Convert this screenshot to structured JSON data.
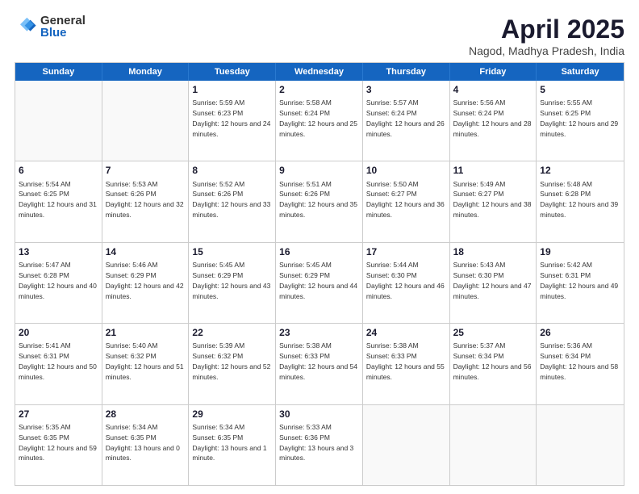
{
  "logo": {
    "general": "General",
    "blue": "Blue"
  },
  "title": "April 2025",
  "subtitle": "Nagod, Madhya Pradesh, India",
  "headers": [
    "Sunday",
    "Monday",
    "Tuesday",
    "Wednesday",
    "Thursday",
    "Friday",
    "Saturday"
  ],
  "rows": [
    [
      {
        "day": "",
        "text": ""
      },
      {
        "day": "",
        "text": ""
      },
      {
        "day": "1",
        "text": "Sunrise: 5:59 AM\nSunset: 6:23 PM\nDaylight: 12 hours and 24 minutes."
      },
      {
        "day": "2",
        "text": "Sunrise: 5:58 AM\nSunset: 6:24 PM\nDaylight: 12 hours and 25 minutes."
      },
      {
        "day": "3",
        "text": "Sunrise: 5:57 AM\nSunset: 6:24 PM\nDaylight: 12 hours and 26 minutes."
      },
      {
        "day": "4",
        "text": "Sunrise: 5:56 AM\nSunset: 6:24 PM\nDaylight: 12 hours and 28 minutes."
      },
      {
        "day": "5",
        "text": "Sunrise: 5:55 AM\nSunset: 6:25 PM\nDaylight: 12 hours and 29 minutes."
      }
    ],
    [
      {
        "day": "6",
        "text": "Sunrise: 5:54 AM\nSunset: 6:25 PM\nDaylight: 12 hours and 31 minutes."
      },
      {
        "day": "7",
        "text": "Sunrise: 5:53 AM\nSunset: 6:26 PM\nDaylight: 12 hours and 32 minutes."
      },
      {
        "day": "8",
        "text": "Sunrise: 5:52 AM\nSunset: 6:26 PM\nDaylight: 12 hours and 33 minutes."
      },
      {
        "day": "9",
        "text": "Sunrise: 5:51 AM\nSunset: 6:26 PM\nDaylight: 12 hours and 35 minutes."
      },
      {
        "day": "10",
        "text": "Sunrise: 5:50 AM\nSunset: 6:27 PM\nDaylight: 12 hours and 36 minutes."
      },
      {
        "day": "11",
        "text": "Sunrise: 5:49 AM\nSunset: 6:27 PM\nDaylight: 12 hours and 38 minutes."
      },
      {
        "day": "12",
        "text": "Sunrise: 5:48 AM\nSunset: 6:28 PM\nDaylight: 12 hours and 39 minutes."
      }
    ],
    [
      {
        "day": "13",
        "text": "Sunrise: 5:47 AM\nSunset: 6:28 PM\nDaylight: 12 hours and 40 minutes."
      },
      {
        "day": "14",
        "text": "Sunrise: 5:46 AM\nSunset: 6:29 PM\nDaylight: 12 hours and 42 minutes."
      },
      {
        "day": "15",
        "text": "Sunrise: 5:45 AM\nSunset: 6:29 PM\nDaylight: 12 hours and 43 minutes."
      },
      {
        "day": "16",
        "text": "Sunrise: 5:45 AM\nSunset: 6:29 PM\nDaylight: 12 hours and 44 minutes."
      },
      {
        "day": "17",
        "text": "Sunrise: 5:44 AM\nSunset: 6:30 PM\nDaylight: 12 hours and 46 minutes."
      },
      {
        "day": "18",
        "text": "Sunrise: 5:43 AM\nSunset: 6:30 PM\nDaylight: 12 hours and 47 minutes."
      },
      {
        "day": "19",
        "text": "Sunrise: 5:42 AM\nSunset: 6:31 PM\nDaylight: 12 hours and 49 minutes."
      }
    ],
    [
      {
        "day": "20",
        "text": "Sunrise: 5:41 AM\nSunset: 6:31 PM\nDaylight: 12 hours and 50 minutes."
      },
      {
        "day": "21",
        "text": "Sunrise: 5:40 AM\nSunset: 6:32 PM\nDaylight: 12 hours and 51 minutes."
      },
      {
        "day": "22",
        "text": "Sunrise: 5:39 AM\nSunset: 6:32 PM\nDaylight: 12 hours and 52 minutes."
      },
      {
        "day": "23",
        "text": "Sunrise: 5:38 AM\nSunset: 6:33 PM\nDaylight: 12 hours and 54 minutes."
      },
      {
        "day": "24",
        "text": "Sunrise: 5:38 AM\nSunset: 6:33 PM\nDaylight: 12 hours and 55 minutes."
      },
      {
        "day": "25",
        "text": "Sunrise: 5:37 AM\nSunset: 6:34 PM\nDaylight: 12 hours and 56 minutes."
      },
      {
        "day": "26",
        "text": "Sunrise: 5:36 AM\nSunset: 6:34 PM\nDaylight: 12 hours and 58 minutes."
      }
    ],
    [
      {
        "day": "27",
        "text": "Sunrise: 5:35 AM\nSunset: 6:35 PM\nDaylight: 12 hours and 59 minutes."
      },
      {
        "day": "28",
        "text": "Sunrise: 5:34 AM\nSunset: 6:35 PM\nDaylight: 13 hours and 0 minutes."
      },
      {
        "day": "29",
        "text": "Sunrise: 5:34 AM\nSunset: 6:35 PM\nDaylight: 13 hours and 1 minute."
      },
      {
        "day": "30",
        "text": "Sunrise: 5:33 AM\nSunset: 6:36 PM\nDaylight: 13 hours and 3 minutes."
      },
      {
        "day": "",
        "text": ""
      },
      {
        "day": "",
        "text": ""
      },
      {
        "day": "",
        "text": ""
      }
    ]
  ]
}
